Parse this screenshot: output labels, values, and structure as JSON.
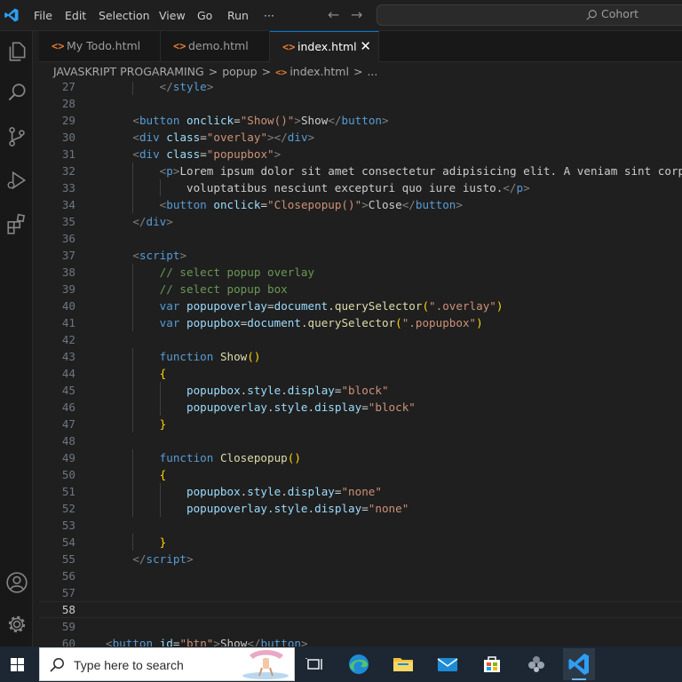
{
  "menu": [
    "File",
    "Edit",
    "Selection",
    "View",
    "Go",
    "Run",
    "···"
  ],
  "command_center": {
    "text": "Cohort",
    "icon": "search-icon"
  },
  "activity_bar": {
    "top": [
      "explorer-icon",
      "search-icon",
      "source-control-icon",
      "run-debug-icon",
      "extensions-icon"
    ],
    "bottom": [
      "account-icon",
      "settings-gear-icon"
    ]
  },
  "tabs": [
    {
      "label": "My Todo.html",
      "icon": "<>",
      "active": false
    },
    {
      "label": "demo.html",
      "icon": "<>",
      "active": false
    },
    {
      "label": "index.html",
      "icon": "<>",
      "active": true,
      "close": "✕"
    }
  ],
  "breadcrumb": {
    "items": [
      "JAVASKRIPT PROGARAMING",
      "popup",
      "index.html",
      "..."
    ],
    "file_icon": "<>",
    "separator": ">"
  },
  "editor": {
    "current_line": 58,
    "lines": [
      {
        "n": "27",
        "t": [
          [
            "tag",
            "        </"
          ],
          [
            "tn",
            "style"
          ],
          [
            "tag",
            ">"
          ]
        ]
      },
      {
        "n": "28",
        "t": []
      },
      {
        "n": "29",
        "t": [
          [
            "tx",
            "    "
          ],
          [
            "tag",
            "<"
          ],
          [
            "tn",
            "button"
          ],
          [
            "tx",
            " "
          ],
          [
            "at",
            "onclick"
          ],
          [
            "tx",
            "="
          ],
          [
            "st",
            "\"Show()\""
          ],
          [
            "tag",
            ">"
          ],
          [
            "tx",
            "Show"
          ],
          [
            "tag",
            "</"
          ],
          [
            "tn",
            "button"
          ],
          [
            "tag",
            ">"
          ]
        ]
      },
      {
        "n": "30",
        "t": [
          [
            "tx",
            "    "
          ],
          [
            "tag",
            "<"
          ],
          [
            "tn",
            "div"
          ],
          [
            "tx",
            " "
          ],
          [
            "at",
            "class"
          ],
          [
            "tx",
            "="
          ],
          [
            "st",
            "\"overlay\""
          ],
          [
            "tag",
            "></"
          ],
          [
            "tn",
            "div"
          ],
          [
            "tag",
            ">"
          ]
        ]
      },
      {
        "n": "31",
        "t": [
          [
            "tx",
            "    "
          ],
          [
            "tag",
            "<"
          ],
          [
            "tn",
            "div"
          ],
          [
            "tx",
            " "
          ],
          [
            "at",
            "class"
          ],
          [
            "tx",
            "="
          ],
          [
            "st",
            "\"popupbox\""
          ],
          [
            "tag",
            ">"
          ]
        ]
      },
      {
        "n": "32",
        "t": [
          [
            "tx",
            "        "
          ],
          [
            "tag",
            "<"
          ],
          [
            "tn",
            "p"
          ],
          [
            "tag",
            ">"
          ],
          [
            "tx",
            "Lorem ipsum dolor sit amet consectetur adipisicing elit. A veniam sint corporis"
          ]
        ]
      },
      {
        "n": "33",
        "t": [
          [
            "tx",
            "            voluptatibus nesciunt excepturi quo iure iusto."
          ],
          [
            "tag",
            "</"
          ],
          [
            "tn",
            "p"
          ],
          [
            "tag",
            ">"
          ]
        ]
      },
      {
        "n": "34",
        "t": [
          [
            "tx",
            "        "
          ],
          [
            "tag",
            "<"
          ],
          [
            "tn",
            "button"
          ],
          [
            "tx",
            " "
          ],
          [
            "at",
            "onclick"
          ],
          [
            "tx",
            "="
          ],
          [
            "st",
            "\"Closepopup()\""
          ],
          [
            "tag",
            ">"
          ],
          [
            "tx",
            "Close"
          ],
          [
            "tag",
            "</"
          ],
          [
            "tn",
            "button"
          ],
          [
            "tag",
            ">"
          ]
        ]
      },
      {
        "n": "35",
        "t": [
          [
            "tx",
            "    "
          ],
          [
            "tag",
            "</"
          ],
          [
            "tn",
            "div"
          ],
          [
            "tag",
            ">"
          ]
        ]
      },
      {
        "n": "36",
        "t": []
      },
      {
        "n": "37",
        "t": [
          [
            "tx",
            "    "
          ],
          [
            "tag",
            "<"
          ],
          [
            "tn",
            "script"
          ],
          [
            "tag",
            ">"
          ]
        ]
      },
      {
        "n": "38",
        "t": [
          [
            "tx",
            "        "
          ],
          [
            "cm",
            "// select popup overlay"
          ]
        ]
      },
      {
        "n": "39",
        "t": [
          [
            "tx",
            "        "
          ],
          [
            "cm",
            "// select popup box"
          ]
        ]
      },
      {
        "n": "40",
        "t": [
          [
            "tx",
            "        "
          ],
          [
            "kw",
            "var"
          ],
          [
            "tx",
            " "
          ],
          [
            "vr",
            "popupoverlay"
          ],
          [
            "pu",
            "="
          ],
          [
            "vr",
            "document"
          ],
          [
            "pu",
            "."
          ],
          [
            "fn",
            "querySelector"
          ],
          [
            "b1",
            "("
          ],
          [
            "st",
            "\".overlay\""
          ],
          [
            "b1",
            ")"
          ]
        ]
      },
      {
        "n": "41",
        "t": [
          [
            "tx",
            "        "
          ],
          [
            "kw",
            "var"
          ],
          [
            "tx",
            " "
          ],
          [
            "vr",
            "popupbox"
          ],
          [
            "pu",
            "="
          ],
          [
            "vr",
            "document"
          ],
          [
            "pu",
            "."
          ],
          [
            "fn",
            "querySelector"
          ],
          [
            "b1",
            "("
          ],
          [
            "st",
            "\".popupbox\""
          ],
          [
            "b1",
            ")"
          ]
        ]
      },
      {
        "n": "42",
        "t": []
      },
      {
        "n": "43",
        "t": [
          [
            "tx",
            "        "
          ],
          [
            "kw",
            "function"
          ],
          [
            "tx",
            " "
          ],
          [
            "fn",
            "Show"
          ],
          [
            "b1",
            "()"
          ]
        ]
      },
      {
        "n": "44",
        "t": [
          [
            "tx",
            "        "
          ],
          [
            "b1",
            "{"
          ]
        ]
      },
      {
        "n": "45",
        "t": [
          [
            "tx",
            "            "
          ],
          [
            "vr",
            "popupbox"
          ],
          [
            "pu",
            "."
          ],
          [
            "vr",
            "style"
          ],
          [
            "pu",
            "."
          ],
          [
            "vr",
            "display"
          ],
          [
            "pu",
            "="
          ],
          [
            "st",
            "\"block\""
          ]
        ]
      },
      {
        "n": "46",
        "t": [
          [
            "tx",
            "            "
          ],
          [
            "vr",
            "popupoverlay"
          ],
          [
            "pu",
            "."
          ],
          [
            "vr",
            "style"
          ],
          [
            "pu",
            "."
          ],
          [
            "vr",
            "display"
          ],
          [
            "pu",
            "="
          ],
          [
            "st",
            "\"block\""
          ]
        ]
      },
      {
        "n": "47",
        "t": [
          [
            "tx",
            "        "
          ],
          [
            "b1",
            "}"
          ]
        ]
      },
      {
        "n": "48",
        "t": []
      },
      {
        "n": "49",
        "t": [
          [
            "tx",
            "        "
          ],
          [
            "kw",
            "function"
          ],
          [
            "tx",
            " "
          ],
          [
            "fn",
            "Closepopup"
          ],
          [
            "b1",
            "()"
          ]
        ]
      },
      {
        "n": "50",
        "t": [
          [
            "tx",
            "        "
          ],
          [
            "b1",
            "{"
          ]
        ]
      },
      {
        "n": "51",
        "t": [
          [
            "tx",
            "            "
          ],
          [
            "vr",
            "popupbox"
          ],
          [
            "pu",
            "."
          ],
          [
            "vr",
            "style"
          ],
          [
            "pu",
            "."
          ],
          [
            "vr",
            "display"
          ],
          [
            "pu",
            "="
          ],
          [
            "st",
            "\"none\""
          ]
        ]
      },
      {
        "n": "52",
        "t": [
          [
            "tx",
            "            "
          ],
          [
            "vr",
            "popupoverlay"
          ],
          [
            "pu",
            "."
          ],
          [
            "vr",
            "style"
          ],
          [
            "pu",
            "."
          ],
          [
            "vr",
            "display"
          ],
          [
            "pu",
            "="
          ],
          [
            "st",
            "\"none\""
          ]
        ]
      },
      {
        "n": "53",
        "t": []
      },
      {
        "n": "54",
        "t": [
          [
            "tx",
            "        "
          ],
          [
            "b1",
            "}"
          ]
        ]
      },
      {
        "n": "55",
        "t": [
          [
            "tx",
            "    "
          ],
          [
            "tag",
            "</"
          ],
          [
            "tn",
            "script"
          ],
          [
            "tag",
            ">"
          ]
        ]
      },
      {
        "n": "56",
        "t": []
      },
      {
        "n": "57",
        "t": []
      },
      {
        "n": "58",
        "t": []
      },
      {
        "n": "59",
        "t": []
      },
      {
        "n": "60",
        "t": [
          [
            "tag",
            "<"
          ],
          [
            "tn",
            "button"
          ],
          [
            "tx",
            " "
          ],
          [
            "at",
            "id"
          ],
          [
            "tx",
            "="
          ],
          [
            "st",
            "\"btn\""
          ],
          [
            "tag",
            ">"
          ],
          [
            "tx",
            "Show"
          ],
          [
            "tag",
            "</"
          ],
          [
            "tn",
            "button"
          ],
          [
            "tag",
            ">"
          ]
        ]
      }
    ]
  },
  "taskbar": {
    "search_placeholder": "Type here to search",
    "apps": [
      "task-view-icon",
      "edge-icon",
      "file-explorer-icon",
      "mail-icon",
      "store-icon",
      "copilot-icon",
      "vscode-icon"
    ]
  },
  "colors": {
    "accent": "#0078d4",
    "taskbar": "#1c2733",
    "editor_bg": "#1f1f1f"
  }
}
